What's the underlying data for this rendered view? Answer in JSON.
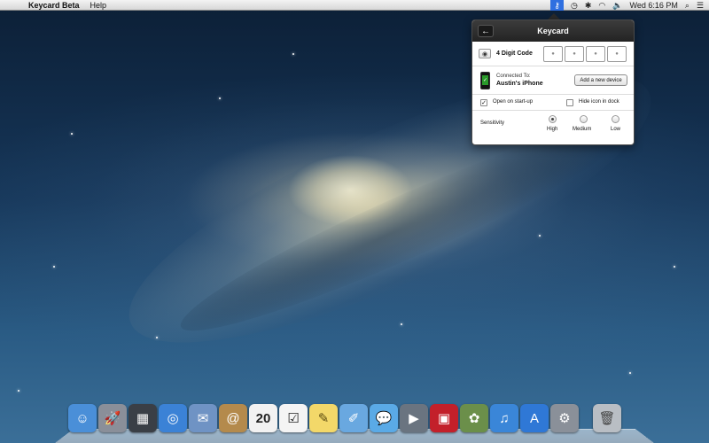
{
  "menubar": {
    "apple_glyph": "",
    "app_name": "Keycard Beta",
    "help_label": "Help",
    "keycard_glyph": "⚷",
    "time_machine_glyph": "◷",
    "bluetooth_glyph": "✱",
    "wifi_glyph": "◠",
    "volume_glyph": "🔈",
    "clock": "Wed 6:16 PM",
    "spotlight_glyph": "⌕",
    "notifications_glyph": "☰"
  },
  "popover": {
    "title": "Keycard",
    "back_glyph": "←",
    "code_label": "4 Digit Code",
    "eye_glyph": "◉",
    "code_digits": [
      "●",
      "●",
      "●",
      "●"
    ],
    "connected_label": "Connected To:",
    "device_name": "Austin's iPhone",
    "add_device_label": "Add a new device",
    "open_on_startup": {
      "label": "Open on start-up",
      "checked": true,
      "glyph": "✓"
    },
    "hide_icon": {
      "label": "Hide icon in dock",
      "checked": false,
      "glyph": ""
    },
    "sensitivity_label": "Sensitivity",
    "sensitivity_options": [
      {
        "label": "High",
        "selected": true
      },
      {
        "label": "Medium",
        "selected": false
      },
      {
        "label": "Low",
        "selected": false
      }
    ]
  },
  "dock": [
    {
      "name": "finder-icon",
      "glyph": "☺",
      "color": "#4a8fd8"
    },
    {
      "name": "launchpad-icon",
      "glyph": "🚀",
      "color": "#8a8f99"
    },
    {
      "name": "mission-control-icon",
      "glyph": "▦",
      "color": "#3a3f46"
    },
    {
      "name": "safari-icon",
      "glyph": "◎",
      "color": "#3b82d6"
    },
    {
      "name": "mail-icon",
      "glyph": "✉",
      "color": "#6f93c4"
    },
    {
      "name": "contacts-icon",
      "glyph": "@",
      "color": "#b48a4c"
    },
    {
      "name": "calendar-icon",
      "glyph": "20",
      "color": "#f2f2f2"
    },
    {
      "name": "reminders-icon",
      "glyph": "☑",
      "color": "#f4f4f4"
    },
    {
      "name": "notes-icon",
      "glyph": "✎",
      "color": "#f3d869"
    },
    {
      "name": "messages-pen-icon",
      "glyph": "✐",
      "color": "#69a8e0"
    },
    {
      "name": "messages-icon",
      "glyph": "💬",
      "color": "#5aaae6"
    },
    {
      "name": "facetime-icon",
      "glyph": "▶",
      "color": "#6a7480"
    },
    {
      "name": "photo-booth-icon",
      "glyph": "▣",
      "color": "#c3202a"
    },
    {
      "name": "iphoto-icon",
      "glyph": "✿",
      "color": "#6b8f4a"
    },
    {
      "name": "itunes-icon",
      "glyph": "♫",
      "color": "#3a86d8"
    },
    {
      "name": "app-store-icon",
      "glyph": "A",
      "color": "#2f78d6"
    },
    {
      "name": "system-preferences-icon",
      "glyph": "⚙",
      "color": "#8a9099"
    },
    {
      "name": "trash-icon",
      "glyph": "🗑",
      "color": "#b9bec4"
    }
  ]
}
